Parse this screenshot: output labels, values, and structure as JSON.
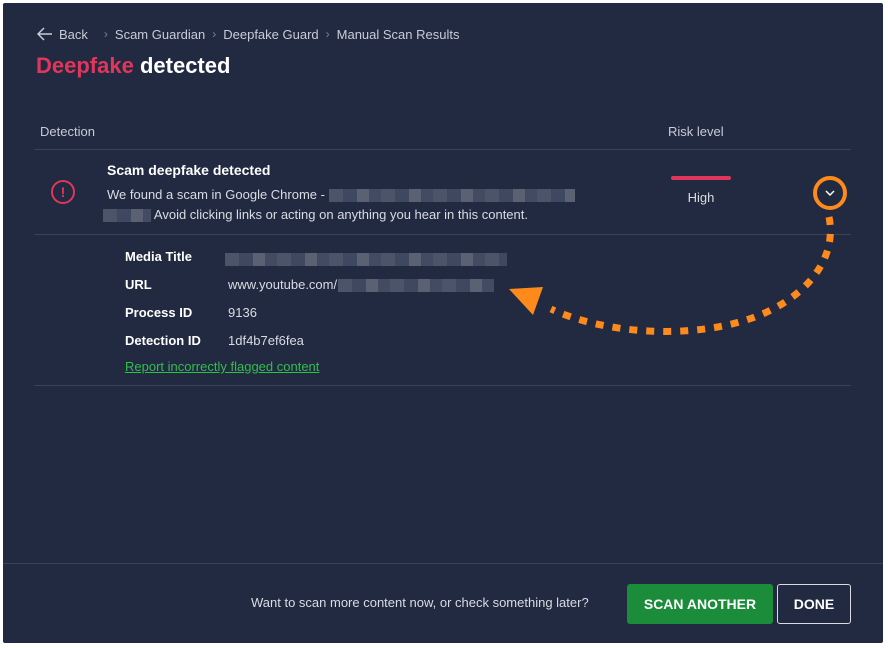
{
  "breadcrumb": {
    "back_label": "Back",
    "items": [
      "Scam Guardian",
      "Deepfake Guard",
      "Manual Scan Results"
    ]
  },
  "title": {
    "accent": "Deepfake",
    "rest": " detected"
  },
  "columns": {
    "detection": "Detection",
    "risk": "Risk level"
  },
  "detection": {
    "title": "Scam deepfake detected",
    "desc_prefix": "We found a scam in Google Chrome -",
    "desc_suffix": "Avoid clicking links or acting on anything you hear in this content.",
    "risk_label": "High",
    "risk_color": "#e0365c"
  },
  "details": {
    "media_title_label": "Media Title",
    "url_label": "URL",
    "url_value": "www.youtube.com/",
    "process_id_label": "Process ID",
    "process_id_value": "9136",
    "detection_id_label": "Detection ID",
    "detection_id_value": "1df4b7ef6fea",
    "report_link": "Report incorrectly flagged content"
  },
  "footer": {
    "prompt": "Want to scan more content now, or check something later?",
    "scan_another": "SCAN ANOTHER",
    "done": "DONE"
  },
  "icons": {
    "back": "arrow-left-icon",
    "separator": "chevron-right-icon",
    "alert": "exclamation-circle-icon",
    "expand": "chevron-down-icon"
  },
  "colors": {
    "background": "#212a40",
    "accent_red": "#e0365c",
    "highlight_orange": "#ff8a1c",
    "primary_green": "#1a8c3a",
    "link_green": "#2fbf4a"
  }
}
